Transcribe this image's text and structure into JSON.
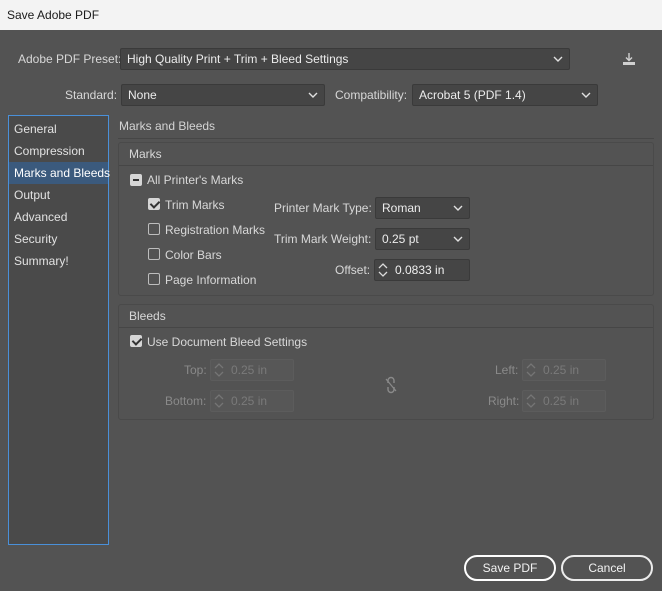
{
  "window": {
    "title": "Save Adobe PDF"
  },
  "preset": {
    "label": "Adobe PDF Preset:",
    "value": "High Quality Print + Trim + Bleed Settings",
    "save_icon": "download-preset-icon"
  },
  "standard": {
    "label": "Standard:",
    "value": "None"
  },
  "compatibility": {
    "label": "Compatibility:",
    "value": "Acrobat 5 (PDF 1.4)"
  },
  "sidebar": {
    "items": [
      {
        "label": "General",
        "active": false
      },
      {
        "label": "Compression",
        "active": false
      },
      {
        "label": "Marks and Bleeds",
        "active": true
      },
      {
        "label": "Output",
        "active": false
      },
      {
        "label": "Advanced",
        "active": false
      },
      {
        "label": "Security",
        "active": false
      },
      {
        "label": "Summary!",
        "active": false
      }
    ]
  },
  "panel": {
    "title": "Marks and Bleeds",
    "marks": {
      "group_label": "Marks",
      "all_printers_marks": {
        "label": "All Printer's Marks",
        "state": "mixed"
      },
      "trim_marks": {
        "label": "Trim Marks",
        "checked": true
      },
      "registration_marks": {
        "label": "Registration Marks",
        "checked": false
      },
      "color_bars": {
        "label": "Color Bars",
        "checked": false
      },
      "page_information": {
        "label": "Page Information",
        "checked": false
      },
      "printer_mark_type": {
        "label": "Printer Mark Type:",
        "value": "Roman"
      },
      "trim_mark_weight": {
        "label": "Trim Mark Weight:",
        "value": "0.25 pt"
      },
      "offset": {
        "label": "Offset:",
        "value": "0.0833 in"
      }
    },
    "bleeds": {
      "group_label": "Bleeds",
      "use_document": {
        "label": "Use Document Bleed Settings",
        "checked": true
      },
      "top": {
        "label": "Top:",
        "value": "0.25 in"
      },
      "bottom": {
        "label": "Bottom:",
        "value": "0.25 in"
      },
      "left": {
        "label": "Left:",
        "value": "0.25 in"
      },
      "right": {
        "label": "Right:",
        "value": "0.25 in"
      },
      "link_icon": "link-broken-icon"
    }
  },
  "footer": {
    "save_label": "Save PDF",
    "cancel_label": "Cancel"
  }
}
